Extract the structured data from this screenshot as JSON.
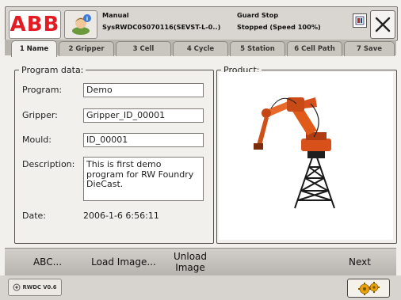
{
  "header": {
    "brand": "ABB",
    "mode": "Manual",
    "system": "SysRWDC05070116(SEVST-L-0..)",
    "state": "Guard Stop",
    "status": "Stopped (Speed 100%)"
  },
  "tabs": [
    {
      "label": "1 Name"
    },
    {
      "label": "2 Gripper"
    },
    {
      "label": "3 Cell"
    },
    {
      "label": "4 Cycle"
    },
    {
      "label": "5 Station"
    },
    {
      "label": "6 Cell Path"
    },
    {
      "label": "7 Save"
    }
  ],
  "program": {
    "section_title": "Program data:",
    "program_label": "Program:",
    "program_value": "Demo",
    "gripper_label": "Gripper:",
    "gripper_value": "Gripper_ID_00001",
    "mould_label": "Mould:",
    "mould_value": "ID_00001",
    "description_label": "Description:",
    "description_lines": [
      "This is first demo",
      "program for RW Foundry",
      "DieCast."
    ],
    "date_label": "Date:",
    "date_value": "2006-1-6 6:56:11"
  },
  "product": {
    "section_title": "Product:"
  },
  "commands": {
    "abc": "ABC...",
    "load_image": "Load Image...",
    "unload_line1": "Unload",
    "unload_line2": "Image",
    "next": "Next"
  },
  "footer": {
    "rwdc_label": "RWDC V0.6"
  },
  "colors": {
    "brand_red": "#e31b23",
    "robot_orange": "#e05a1a",
    "selected_tab": "#f2f0ec"
  }
}
